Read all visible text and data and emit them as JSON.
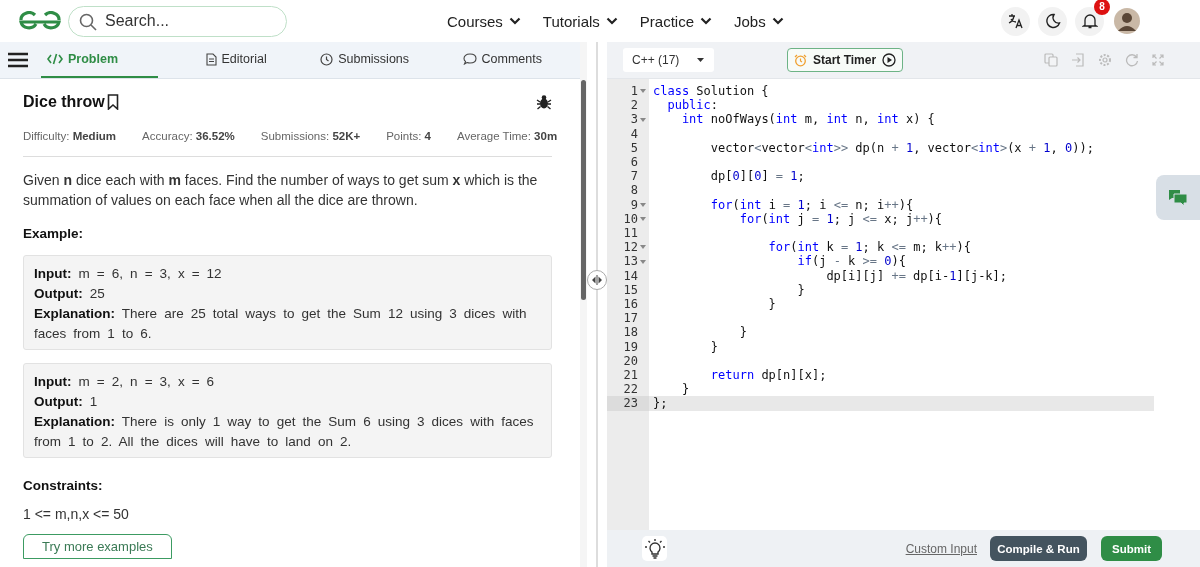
{
  "header": {
    "search": {
      "placeholder": "Search..."
    },
    "nav": [
      {
        "label": "Courses"
      },
      {
        "label": "Tutorials"
      },
      {
        "label": "Practice"
      },
      {
        "label": "Jobs"
      }
    ],
    "notification_count": "8"
  },
  "problem_tabs": [
    {
      "label": "Problem",
      "selected": true
    },
    {
      "label": "Editorial",
      "selected": false
    },
    {
      "label": "Submissions",
      "selected": false
    },
    {
      "label": "Comments",
      "selected": false
    }
  ],
  "problem": {
    "title": "Dice throw",
    "stats": [
      "Difficulty: **Medium**",
      "Accuracy: **36.52%**",
      "Submissions: **52K+**",
      "Points: **4**",
      "Average Time: **30m**"
    ],
    "description": "Given **n** dice each with **m** faces. Find the number of ways to get sum **x** which is the summation of values on each face when all the dice are thrown.",
    "example_heading": "Example:",
    "examples": [
      {
        "input": "**Input:** m = 6, n = 3, x = 12",
        "output": "**Output:** 25",
        "explanation": "**Explanation:** There are 25 total ways to get the Sum 12 using 3 dices with faces from 1 to 6."
      },
      {
        "input": "**Input:** m = 2, n = 3, x = 6",
        "output": "**Output:** 1",
        "explanation": "**Explanation:** There is only 1 way to get the Sum 6 using 3 dices with faces from 1 to 2. All the dices will have to land on 2."
      }
    ],
    "constraints_heading": "Constraints:",
    "constraints": "1 <= m,n,x <= 50",
    "more_button": "Try more examples"
  },
  "editor": {
    "language": "C++ (17)",
    "timer_button": "Start Timer",
    "lines": [
      {
        "number": "1",
        "foldable": true,
        "active": false,
        "tokens": [
          {
            "kind": "kw",
            "text": "class"
          },
          {
            "kind": "text",
            "text": " Solution {"
          }
        ]
      },
      {
        "number": "2",
        "foldable": false,
        "active": false,
        "tokens": [
          {
            "kind": "kw",
            "text": "  public"
          },
          {
            "kind": "text",
            "text": ":"
          }
        ]
      },
      {
        "number": "3",
        "foldable": true,
        "active": false,
        "tokens": [
          {
            "kind": "kw",
            "text": "    int"
          },
          {
            "kind": "text",
            "text": " noOfWays("
          },
          {
            "kind": "kw",
            "text": "int"
          },
          {
            "kind": "text",
            "text": " m, "
          },
          {
            "kind": "kw",
            "text": "int"
          },
          {
            "kind": "text",
            "text": " n, "
          },
          {
            "kind": "kw",
            "text": "int"
          },
          {
            "kind": "text",
            "text": " x) {"
          }
        ]
      },
      {
        "number": "4",
        "foldable": false,
        "active": false
      },
      {
        "number": "5",
        "foldable": false,
        "active": false,
        "tokens": [
          {
            "kind": "text",
            "text": "        vector"
          },
          {
            "kind": "op",
            "text": "<"
          },
          {
            "kind": "text",
            "text": "vector"
          },
          {
            "kind": "op",
            "text": "<"
          },
          {
            "kind": "kw",
            "text": "int"
          },
          {
            "kind": "op",
            "text": ">>"
          },
          {
            "kind": "text",
            "text": " dp(n "
          },
          {
            "kind": "op",
            "text": "+"
          },
          {
            "kind": "num",
            "text": " 1"
          },
          {
            "kind": "text",
            "text": ", vector"
          },
          {
            "kind": "op",
            "text": "<"
          },
          {
            "kind": "kw",
            "text": "int"
          },
          {
            "kind": "op",
            "text": ">"
          },
          {
            "kind": "text",
            "text": "(x "
          },
          {
            "kind": "op",
            "text": "+"
          },
          {
            "kind": "num",
            "text": " 1"
          },
          {
            "kind": "text",
            "text": ", "
          },
          {
            "kind": "num",
            "text": "0"
          },
          {
            "kind": "text",
            "text": "));"
          }
        ]
      },
      {
        "number": "6",
        "foldable": false,
        "active": false
      },
      {
        "number": "7",
        "foldable": false,
        "active": false,
        "tokens": [
          {
            "kind": "text",
            "text": "        dp["
          },
          {
            "kind": "num",
            "text": "0"
          },
          {
            "kind": "text",
            "text": "]["
          },
          {
            "kind": "num",
            "text": "0"
          },
          {
            "kind": "text",
            "text": "] "
          },
          {
            "kind": "op",
            "text": "="
          },
          {
            "kind": "num",
            "text": " 1"
          },
          {
            "kind": "text",
            "text": ";"
          }
        ]
      },
      {
        "number": "8",
        "foldable": false,
        "active": false
      },
      {
        "number": "9",
        "foldable": true,
        "active": false,
        "tokens": [
          {
            "kind": "kw",
            "text": "        for"
          },
          {
            "kind": "text",
            "text": "("
          },
          {
            "kind": "kw",
            "text": "int"
          },
          {
            "kind": "text",
            "text": " i "
          },
          {
            "kind": "op",
            "text": "="
          },
          {
            "kind": "num",
            "text": " 1"
          },
          {
            "kind": "text",
            "text": "; i "
          },
          {
            "kind": "op",
            "text": "<="
          },
          {
            "kind": "text",
            "text": " n; i"
          },
          {
            "kind": "op",
            "text": "++"
          },
          {
            "kind": "text",
            "text": "){"
          }
        ]
      },
      {
        "number": "10",
        "foldable": true,
        "active": false,
        "tokens": [
          {
            "kind": "kw",
            "text": "            for"
          },
          {
            "kind": "text",
            "text": "("
          },
          {
            "kind": "kw",
            "text": "int"
          },
          {
            "kind": "text",
            "text": " j "
          },
          {
            "kind": "op",
            "text": "="
          },
          {
            "kind": "num",
            "text": " 1"
          },
          {
            "kind": "text",
            "text": "; j "
          },
          {
            "kind": "op",
            "text": "<="
          },
          {
            "kind": "text",
            "text": " x; j"
          },
          {
            "kind": "op",
            "text": "++"
          },
          {
            "kind": "text",
            "text": "){"
          }
        ]
      },
      {
        "number": "11",
        "foldable": false,
        "active": false
      },
      {
        "number": "12",
        "foldable": true,
        "active": false,
        "tokens": [
          {
            "kind": "kw",
            "text": "                for"
          },
          {
            "kind": "text",
            "text": "("
          },
          {
            "kind": "kw",
            "text": "int"
          },
          {
            "kind": "text",
            "text": " k "
          },
          {
            "kind": "op",
            "text": "="
          },
          {
            "kind": "num",
            "text": " 1"
          },
          {
            "kind": "text",
            "text": "; k "
          },
          {
            "kind": "op",
            "text": "<="
          },
          {
            "kind": "text",
            "text": " m; k"
          },
          {
            "kind": "op",
            "text": "++"
          },
          {
            "kind": "text",
            "text": "){"
          }
        ]
      },
      {
        "number": "13",
        "foldable": true,
        "active": false,
        "tokens": [
          {
            "kind": "kw",
            "text": "                    if"
          },
          {
            "kind": "text",
            "text": "(j "
          },
          {
            "kind": "op",
            "text": "-"
          },
          {
            "kind": "text",
            "text": " k "
          },
          {
            "kind": "op",
            "text": ">="
          },
          {
            "kind": "num",
            "text": " 0"
          },
          {
            "kind": "text",
            "text": "){"
          }
        ]
      },
      {
        "number": "14",
        "foldable": false,
        "active": false,
        "tokens": [
          {
            "kind": "text",
            "text": "                        dp[i][j] "
          },
          {
            "kind": "op",
            "text": "+="
          },
          {
            "kind": "text",
            "text": " dp[i-"
          },
          {
            "kind": "num",
            "text": "1"
          },
          {
            "kind": "text",
            "text": "][j-k];"
          }
        ]
      },
      {
        "number": "15",
        "foldable": false,
        "active": false,
        "tokens": [
          {
            "kind": "text",
            "text": "                    }"
          }
        ]
      },
      {
        "number": "16",
        "foldable": false,
        "active": false,
        "tokens": [
          {
            "kind": "text",
            "text": "                }"
          }
        ]
      },
      {
        "number": "17",
        "foldable": false,
        "active": false
      },
      {
        "number": "18",
        "foldable": false,
        "active": false,
        "tokens": [
          {
            "kind": "text",
            "text": "            }"
          }
        ]
      },
      {
        "number": "19",
        "foldable": false,
        "active": false,
        "tokens": [
          {
            "kind": "text",
            "text": "        }"
          }
        ]
      },
      {
        "number": "20",
        "foldable": false,
        "active": false
      },
      {
        "number": "21",
        "foldable": false,
        "active": false,
        "tokens": [
          {
            "kind": "kw",
            "text": "        return"
          },
          {
            "kind": "text",
            "text": " dp[n][x];"
          }
        ]
      },
      {
        "number": "22",
        "foldable": false,
        "active": false,
        "tokens": [
          {
            "kind": "text",
            "text": "    }"
          }
        ]
      },
      {
        "number": "23",
        "foldable": false,
        "active": true,
        "tokens": [
          {
            "kind": "text",
            "text": "};"
          }
        ]
      }
    ],
    "custom_input": "Custom Input",
    "compile_button": "Compile & Run",
    "submit_button": "Submit"
  }
}
